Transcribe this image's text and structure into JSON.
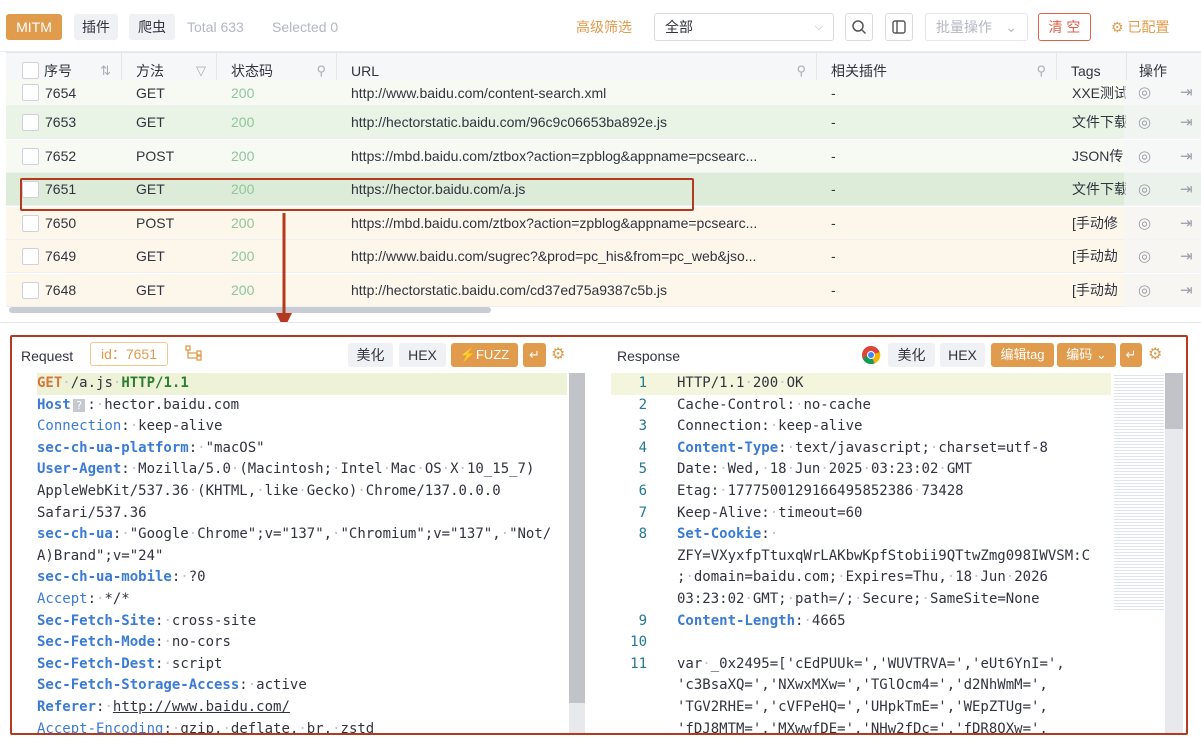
{
  "toolbar": {
    "mitm_label": "MITM",
    "plugin_label": "插件",
    "crawler_label": "爬虫",
    "total_label": "Total",
    "total_value": "633",
    "selected_label": "Selected",
    "selected_value": "0",
    "advanced_filter": "高级筛选",
    "filter_select_value": "全部",
    "batch_label": "批量操作",
    "clear_label": "清 空",
    "config_label": "已配置"
  },
  "table": {
    "headers": [
      "序号",
      "方法",
      "状态码",
      "URL",
      "相关插件",
      "Tags",
      "操作"
    ],
    "rows": [
      {
        "id": "7654",
        "method": "GET",
        "status": "200",
        "url": "http://www.baidu.com/content-search.xml",
        "plugin": "-",
        "tags": "XXE测试"
      },
      {
        "id": "7653",
        "method": "GET",
        "status": "200",
        "url": "http://hectorstatic.baidu.com/96c9c06653ba892e.js",
        "plugin": "-",
        "tags": "文件下载"
      },
      {
        "id": "7652",
        "method": "POST",
        "status": "200",
        "url": "https://mbd.baidu.com/ztbox?action=zpblog&appname=pcsearc...",
        "plugin": "-",
        "tags": "JSON传"
      },
      {
        "id": "7651",
        "method": "GET",
        "status": "200",
        "url": "https://hector.baidu.com/a.js",
        "plugin": "-",
        "tags": "文件下载"
      },
      {
        "id": "7650",
        "method": "POST",
        "status": "200",
        "url": "https://mbd.baidu.com/ztbox?action=zpblog&appname=pcsearc...",
        "plugin": "-",
        "tags": "[手动修"
      },
      {
        "id": "7649",
        "method": "GET",
        "status": "200",
        "url": "http://www.baidu.com/sugrec?&prod=pc_his&from=pc_web&jso...",
        "plugin": "-",
        "tags": "[手动劫"
      },
      {
        "id": "7648",
        "method": "GET",
        "status": "200",
        "url": "http://hectorstatic.baidu.com/cd37ed75a9387c5b.js",
        "plugin": "-",
        "tags": "[手动劫"
      }
    ]
  },
  "request": {
    "title": "Request",
    "id_label": "id：7651",
    "beautify": "美化",
    "hex": "HEX",
    "fuzz": "FUZZ",
    "lines": [
      {
        "key": "GET",
        "sep": " /a.js ",
        "val": "HTTP/1.1",
        "style": "first"
      },
      {
        "key": "Host",
        "sep": ": ",
        "val": "hector.baidu.com",
        "style": "host"
      },
      {
        "key": "Connection",
        "sep": ": ",
        "val": "keep-alive",
        "style": "plain"
      },
      {
        "key": "sec-ch-ua-platform",
        "sep": ": ",
        "val": "\"macOS\"",
        "style": "bold"
      },
      {
        "key": "User-Agent",
        "sep": ": ",
        "val": "Mozilla/5.0 (Macintosh; Intel Mac OS X 10_15_7)",
        "style": "bold"
      },
      {
        "key": "",
        "sep": "",
        "val": "AppleWebKit/537.36 (KHTML, like Gecko) Chrome/137.0.0.0",
        "style": "cont"
      },
      {
        "key": "",
        "sep": "",
        "val": "Safari/537.36",
        "style": "cont"
      },
      {
        "key": "sec-ch-ua",
        "sep": ": ",
        "val": "\"Google Chrome\";v=\"137\", \"Chromium\";v=\"137\", \"Not/",
        "style": "bold"
      },
      {
        "key": "",
        "sep": "",
        "val": "A)Brand\";v=\"24\"",
        "style": "cont"
      },
      {
        "key": "sec-ch-ua-mobile",
        "sep": ": ",
        "val": "?0",
        "style": "bold"
      },
      {
        "key": "Accept",
        "sep": ": ",
        "val": "*/*",
        "style": "plain"
      },
      {
        "key": "Sec-Fetch-Site",
        "sep": ": ",
        "val": "cross-site",
        "style": "bold"
      },
      {
        "key": "Sec-Fetch-Mode",
        "sep": ": ",
        "val": "no-cors",
        "style": "bold"
      },
      {
        "key": "Sec-Fetch-Dest",
        "sep": ": ",
        "val": "script",
        "style": "bold"
      },
      {
        "key": "Sec-Fetch-Storage-Access",
        "sep": ": ",
        "val": "active",
        "style": "bold"
      },
      {
        "key": "Referer",
        "sep": ": ",
        "val": "http://www.baidu.com/",
        "style": "link"
      },
      {
        "key": "Accept-Encoding",
        "sep": ": ",
        "val": "gzip, deflate, br, zstd",
        "style": "plain"
      }
    ]
  },
  "response": {
    "title": "Response",
    "beautify": "美化",
    "hex": "HEX",
    "edit_tag": "编辑tag",
    "encoding": "编码",
    "lines": [
      {
        "n": "1",
        "key": "",
        "sep": "",
        "val": "HTTP/1.1 200 OK",
        "style": "cont"
      },
      {
        "n": "2",
        "key": "Cache-Control",
        "sep": ": ",
        "val": "no-cache",
        "style": "dark"
      },
      {
        "n": "3",
        "key": "Connection",
        "sep": ": ",
        "val": "keep-alive",
        "style": "dark"
      },
      {
        "n": "4",
        "key": "Content-Type",
        "sep": ": ",
        "val": "text/javascript; charset=utf-8",
        "style": "bold"
      },
      {
        "n": "5",
        "key": "Date",
        "sep": ": ",
        "val": "Wed, 18 Jun 2025 03:23:02 GMT",
        "style": "dark"
      },
      {
        "n": "6",
        "key": "Etag",
        "sep": ": ",
        "val": "1777500129166495852386 73428",
        "style": "dark"
      },
      {
        "n": "7",
        "key": "Keep-Alive",
        "sep": ": ",
        "val": "timeout=60",
        "style": "dark"
      },
      {
        "n": "8",
        "key": "Set-Cookie",
        "sep": ": ",
        "val": "",
        "style": "bold"
      },
      {
        "n": "",
        "key": "",
        "sep": "",
        "val": "ZFY=VXyxfpTtuxqWrLAKbwKpfStobii9QTtwZmg098IWVSM:C",
        "style": "cont"
      },
      {
        "n": "",
        "key": "",
        "sep": "",
        "val": "; domain=baidu.com; Expires=Thu, 18 Jun 2026",
        "style": "cont"
      },
      {
        "n": "",
        "key": "",
        "sep": "",
        "val": "03:23:02 GMT; path=/; Secure; SameSite=None",
        "style": "cont"
      },
      {
        "n": "9",
        "key": "Content-Length",
        "sep": ": ",
        "val": "4665",
        "style": "bold"
      },
      {
        "n": "10",
        "key": "",
        "sep": "",
        "val": "",
        "style": "cont"
      },
      {
        "n": "11",
        "key": "",
        "sep": "",
        "val": "var _0x2495=['cEdPUUk=','WUVTRVA=','eUt6YnI=',",
        "style": "cont"
      },
      {
        "n": "",
        "key": "",
        "sep": "",
        "val": "'c3BsaXQ=','NXwxMXw=','TGlOcm4=','d2NhWmM=',",
        "style": "cont"
      },
      {
        "n": "",
        "key": "",
        "sep": "",
        "val": "'TGV2RHE=','cVFPeHQ=','UHpkTmE=','WEpZTUg=',",
        "style": "cont"
      },
      {
        "n": "",
        "key": "",
        "sep": "",
        "val": "'fDJ8MTM=','MXwwfDE=','NHw2fDc=','fDR8OXw=',",
        "style": "cont"
      }
    ]
  },
  "colors": {
    "accent": "#e09b4c",
    "danger": "#e0614b",
    "highlight": "#b33a1e"
  },
  "icons": [
    "search-icon",
    "filter-toggle-icon",
    "settings-gear-icon",
    "sort-icon",
    "funnel-icon",
    "chrome-icon",
    "open-icon",
    "tree-icon",
    "wrap-icon",
    "bolt-icon"
  ]
}
